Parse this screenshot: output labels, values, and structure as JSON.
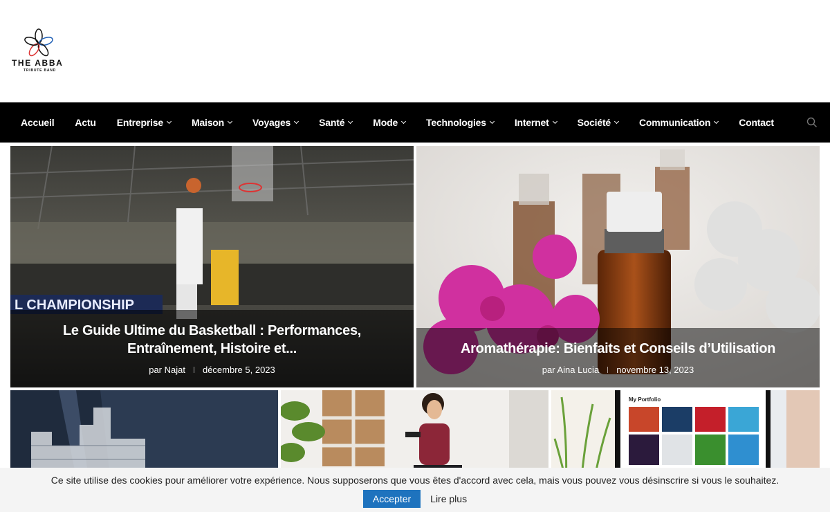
{
  "site": {
    "logo_main": "THE ABBA",
    "logo_sub": "TRIBUTE BAND"
  },
  "nav": {
    "items": [
      {
        "label": "Accueil",
        "dropdown": false
      },
      {
        "label": "Actu",
        "dropdown": false
      },
      {
        "label": "Entreprise",
        "dropdown": true
      },
      {
        "label": "Maison",
        "dropdown": true
      },
      {
        "label": "Voyages",
        "dropdown": true
      },
      {
        "label": "Santé",
        "dropdown": true
      },
      {
        "label": "Mode",
        "dropdown": true
      },
      {
        "label": "Technologies",
        "dropdown": true
      },
      {
        "label": "Internet",
        "dropdown": true
      },
      {
        "label": "Société",
        "dropdown": true
      },
      {
        "label": "Communication",
        "dropdown": true
      },
      {
        "label": "Contact",
        "dropdown": false
      }
    ],
    "search_icon": "search-icon"
  },
  "featured": [
    {
      "title": "Le Guide Ultime du Basketball : Performances, Entraînement, Histoire et...",
      "author": "par Najat",
      "date": "décembre 5, 2023",
      "image_text": "L CHAMPIONSHIP"
    },
    {
      "title": "Aromathérapie: Bienfaits et Conseils d’Utilisation",
      "author": "par Aina Lucia",
      "date": "novembre 13, 2023"
    }
  ],
  "small_cards": [
    {
      "image_text": ""
    },
    {
      "image_text": ""
    },
    {
      "image_text": "My Portfolio"
    }
  ],
  "cookie": {
    "text": "Ce site utilise des cookies pour améliorer votre expérience. Nous supposerons que vous êtes d'accord avec cela, mais vous pouvez vous désinscrire si vous le souhaitez.",
    "accept_label": "Accepter",
    "read_more_label": "Lire plus",
    "accept_color": "#1e73be"
  }
}
